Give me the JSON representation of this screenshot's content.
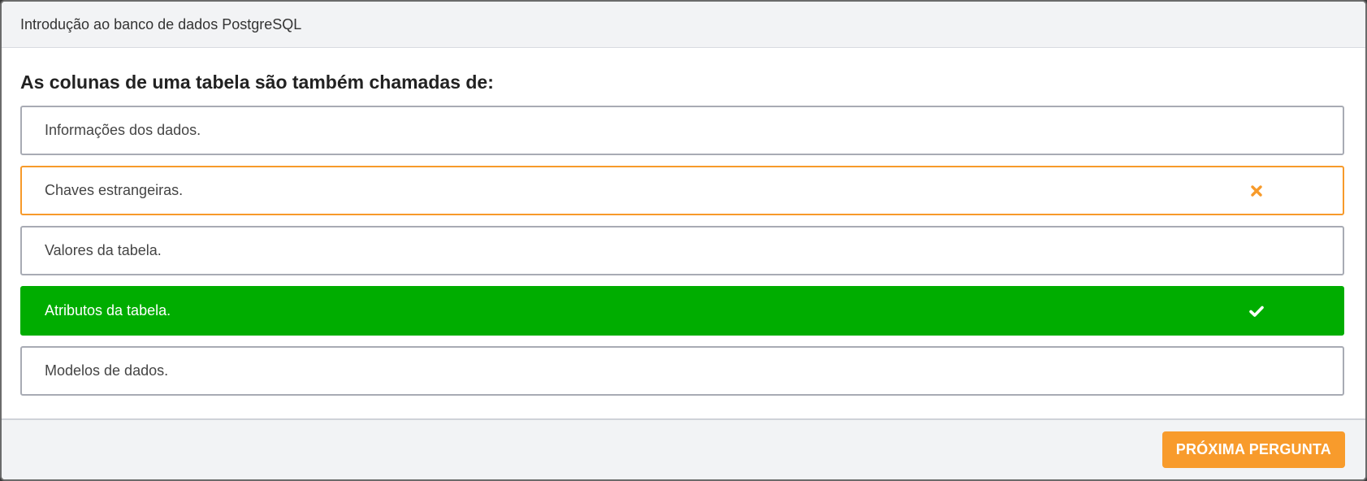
{
  "header": {
    "title": "Introdução ao banco de dados PostgreSQL"
  },
  "question": {
    "text": "As colunas de uma tabela são também chamadas de:"
  },
  "options": [
    {
      "label": "Informações dos dados.",
      "state": "neutral"
    },
    {
      "label": "Chaves estrangeiras.",
      "state": "wrong",
      "icon": "x-icon"
    },
    {
      "label": "Valores da tabela.",
      "state": "neutral"
    },
    {
      "label": "Atributos da tabela.",
      "state": "correct",
      "icon": "check-icon"
    },
    {
      "label": "Modelos de dados.",
      "state": "neutral"
    }
  ],
  "footer": {
    "next_label": "PRÓXIMA PERGUNTA"
  },
  "colors": {
    "wrong": "#f79a2a",
    "correct": "#00ad00",
    "accent": "#f89b2c"
  }
}
